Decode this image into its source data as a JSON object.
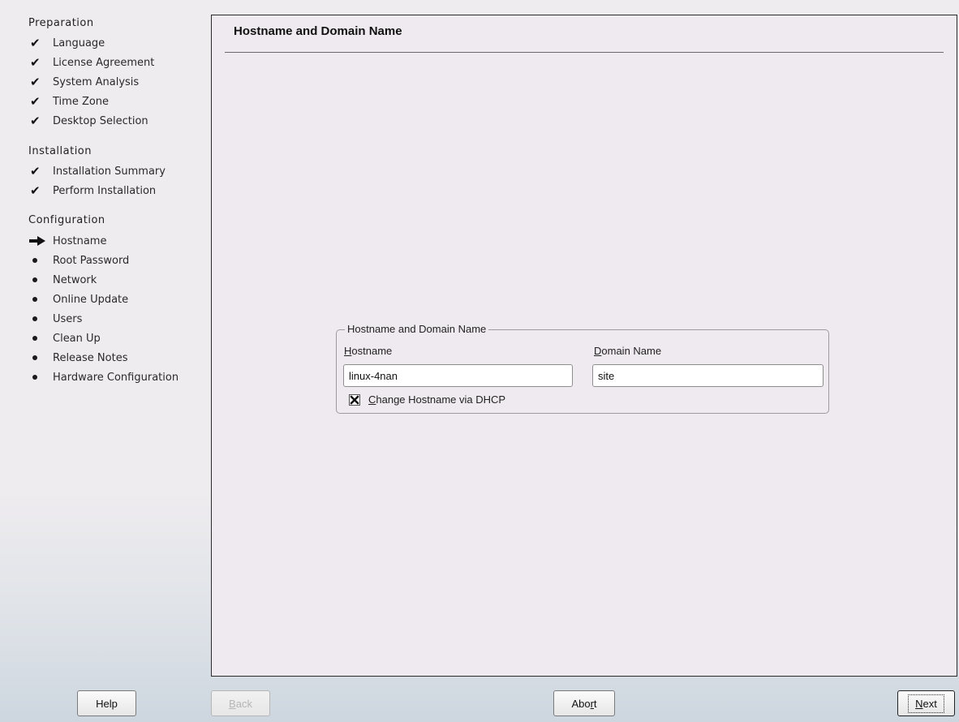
{
  "sidebar": {
    "sections": [
      {
        "title": "Preparation"
      },
      {
        "title": "Installation"
      },
      {
        "title": "Configuration"
      }
    ],
    "steps": [
      {
        "label": "Language",
        "status": "done"
      },
      {
        "label": "License Agreement",
        "status": "done"
      },
      {
        "label": "System Analysis",
        "status": "done"
      },
      {
        "label": "Time Zone",
        "status": "done"
      },
      {
        "label": "Desktop Selection",
        "status": "done"
      },
      {
        "label": "Installation Summary",
        "status": "done"
      },
      {
        "label": "Perform Installation",
        "status": "done"
      },
      {
        "label": "Hostname",
        "status": "current"
      },
      {
        "label": "Root Password",
        "status": "pending"
      },
      {
        "label": "Network",
        "status": "pending"
      },
      {
        "label": "Online Update",
        "status": "pending"
      },
      {
        "label": "Users",
        "status": "pending"
      },
      {
        "label": "Clean Up",
        "status": "pending"
      },
      {
        "label": "Release Notes",
        "status": "pending"
      },
      {
        "label": "Hardware Configuration",
        "status": "pending"
      }
    ]
  },
  "main": {
    "title": "Hostname and Domain Name",
    "group_title": "Hostname and Domain Name",
    "hostname_label_mnemonic": "H",
    "hostname_label_rest": "ostname",
    "hostname_value": "linux-4nan",
    "domain_label_mnemonic": "D",
    "domain_label_rest": "omain Name",
    "domain_value": "site",
    "dhcp_label_mnemonic": "C",
    "dhcp_label_rest": "hange Hostname via DHCP",
    "dhcp_checked": true
  },
  "buttons": {
    "help": "Help",
    "back_mnemonic": "B",
    "back_rest": "ack",
    "abort_prefix": "Abo",
    "abort_mnemonic": "r",
    "abort_suffix": "t",
    "next_mnemonic": "N",
    "next_rest": "ext"
  },
  "icons": {
    "done": "check-icon",
    "current": "arrow-right-icon",
    "pending": "bullet-icon",
    "checkbox": "x-mark-icon"
  }
}
